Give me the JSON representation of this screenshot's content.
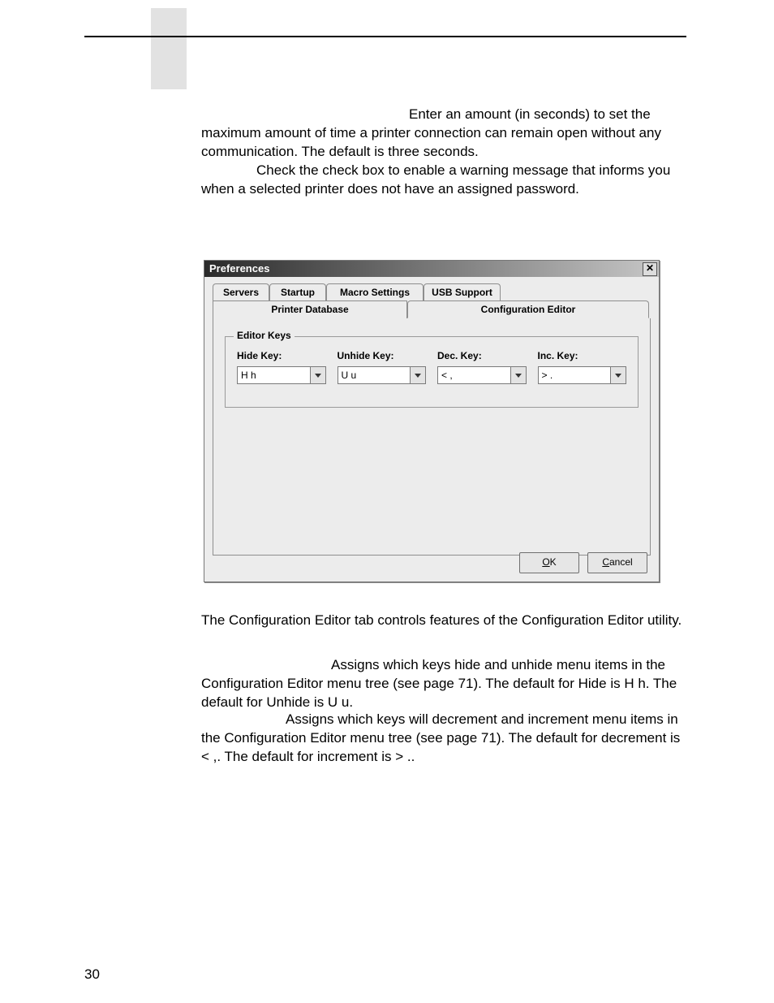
{
  "paragraphs": {
    "p1": "Enter an amount (in seconds) to set the maximum amount of time a printer connection can remain open without any communication. The default is three seconds.",
    "p2": "Check the check box to enable a warning message that informs you when a selected printer does not have an assigned password.",
    "p3": "The Configuration Editor tab controls features of the Configuration Editor utility.",
    "p4": "Assigns which keys hide and unhide menu items in the Configuration Editor menu tree (see page 71). The default for Hide is H h. The default for Unhide is U u.",
    "p5": "Assigns which keys will decrement and increment menu items in the Configuration Editor menu tree (see page 71). The default for decrement is < ,. The default for increment is > .."
  },
  "page_number": "30",
  "dialog": {
    "title": "Preferences",
    "close_glyph": "✕",
    "tabs": {
      "servers": "Servers",
      "startup": "Startup",
      "macro": "Macro Settings",
      "usb": "USB Support",
      "printerdb": "Printer Database",
      "configed": "Configuration Editor"
    },
    "group_legend": "Editor Keys",
    "keys": {
      "hide": {
        "label": "Hide Key:",
        "value": "H h"
      },
      "unhide": {
        "label": "Unhide Key:",
        "value": "U u"
      },
      "dec": {
        "label": "Dec. Key:",
        "value": "< ,"
      },
      "inc": {
        "label": "Inc. Key:",
        "value": "> ."
      }
    },
    "buttons": {
      "ok_u": "O",
      "ok_rest": "K",
      "cancel_u": "C",
      "cancel_rest": "ancel"
    }
  }
}
